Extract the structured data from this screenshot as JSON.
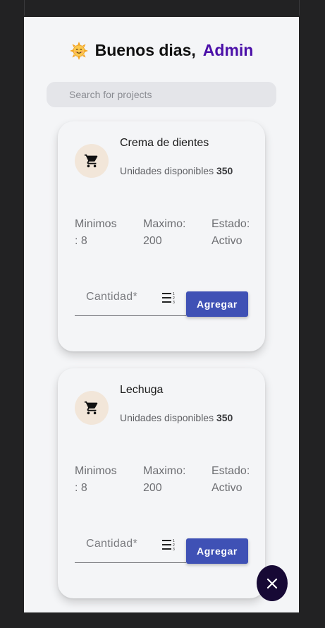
{
  "header": {
    "greeting": "Buenos dias,",
    "user": "Admin",
    "emoji_icon": "smiling-sun-icon"
  },
  "search": {
    "placeholder": "Search for projects",
    "icon": "search-icon"
  },
  "colors": {
    "background": "#222223",
    "app_background": "#f4f5f7",
    "admin_accent": "#4b0fa8",
    "button": "#3f51b5",
    "fab": "#170935",
    "icon_circle": "#f2e6d9"
  },
  "products": [
    {
      "name": "Crema de dientes",
      "units_label": "Unidades disponibles",
      "units_value": "350",
      "min_line1": "Minimos",
      "min_line2": ": 8",
      "max_line1": "Maximo:",
      "max_line2": "200",
      "state_line1": "Estado:",
      "state_line2": "Activo",
      "qty_label": "Cantidad*",
      "button_label": "Agregar"
    },
    {
      "name": "Lechuga",
      "units_label": "Unidades disponibles",
      "units_value": "350",
      "min_line1": "Minimos",
      "min_line2": ": 8",
      "max_line1": "Maximo:",
      "max_line2": "200",
      "state_line1": "Estado:",
      "state_line2": "Activo",
      "qty_label": "Cantidad*",
      "button_label": "Agregar"
    }
  ],
  "fab": {
    "icon": "close-icon"
  }
}
